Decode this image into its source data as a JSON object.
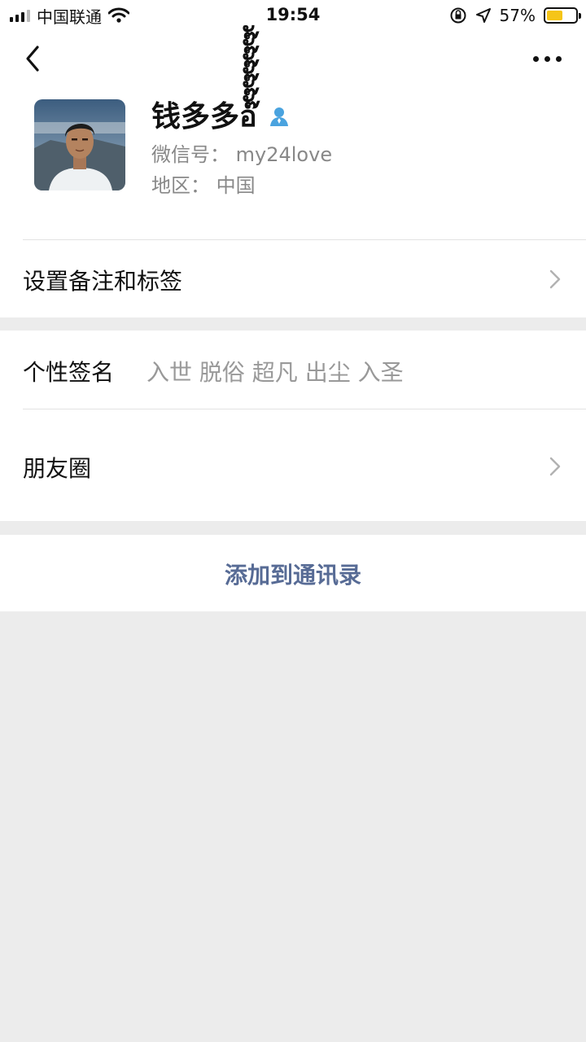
{
  "status_bar": {
    "carrier": "中国联通",
    "time": "19:54",
    "battery_percent": "57%",
    "battery_level": 0.57,
    "icons": [
      "signal-icon",
      "wifi-icon",
      "orientation-lock-icon",
      "location-icon",
      "battery-icon"
    ]
  },
  "nav": {
    "back_icon": "chevron-left-icon",
    "more_icon": "more-dots-icon"
  },
  "profile": {
    "name": "钱多多อ๊ั๊ั๊ั๊ั๊ั๊ั",
    "badge_icon": "person-badge-icon",
    "wechat_id_label": "微信号：",
    "wechat_id_value": "my24love",
    "region_label": "地区：",
    "region_value": "中国"
  },
  "rows": {
    "remark_label": "设置备注和标签",
    "signature_label": "个性签名",
    "signature_value": "入世 脱俗 超凡 出尘 入圣",
    "moments_label": "朋友圈",
    "add_contact_label": "添加到通讯录"
  },
  "colors": {
    "link": "#576b95",
    "background": "#ececec",
    "battery": "#f5c518",
    "badge": "#4aa3df"
  }
}
